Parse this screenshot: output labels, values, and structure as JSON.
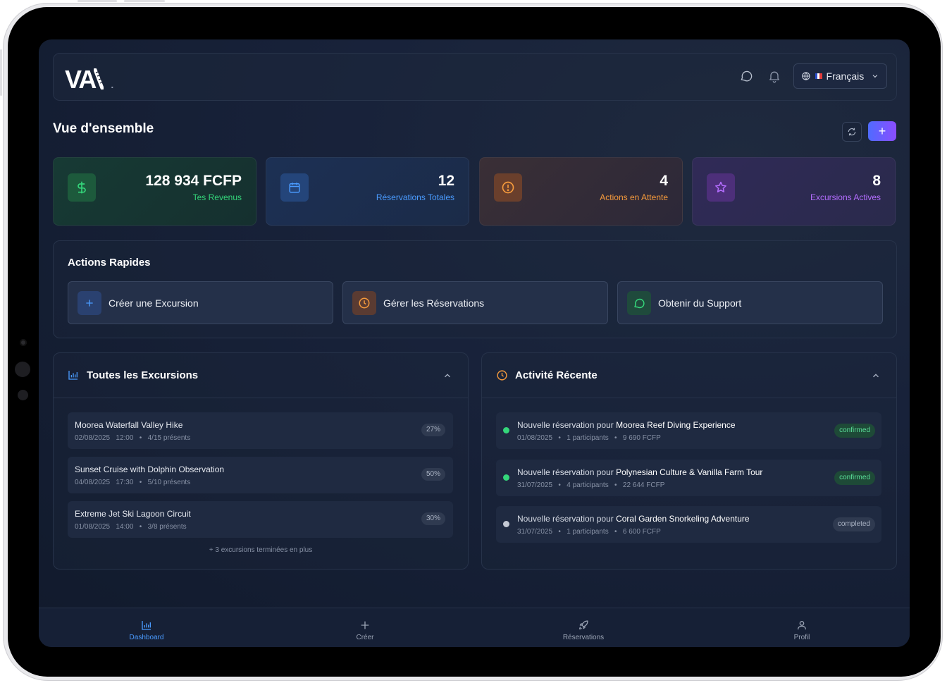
{
  "app": {
    "logo": "VA",
    "logo_suffix": "."
  },
  "header": {
    "language": "Français"
  },
  "page": {
    "title": "Vue d'ensemble",
    "add_label": "+"
  },
  "stats": [
    {
      "value": "128 934 FCFP",
      "label": "Tes Revenus",
      "icon": "dollar-icon",
      "color": "#34d67a"
    },
    {
      "value": "12",
      "label": "Réservations Totales",
      "icon": "calendar-icon",
      "color": "#4a9bff"
    },
    {
      "value": "4",
      "label": "Actions en Attente",
      "icon": "alert-icon",
      "color": "#f59a3c"
    },
    {
      "value": "8",
      "label": "Excursions Actives",
      "icon": "star-icon",
      "color": "#b46dff"
    }
  ],
  "quick_actions": {
    "title": "Actions Rapides",
    "items": [
      {
        "label": "Créer une Excursion",
        "icon": "plus-icon",
        "color": "#4a9bff"
      },
      {
        "label": "Gérer les Réservations",
        "icon": "clock-icon",
        "color": "#f59a3c"
      },
      {
        "label": "Obtenir du Support",
        "icon": "chat-icon",
        "color": "#34d67a"
      }
    ]
  },
  "excursions": {
    "title": "Toutes les Excursions",
    "items": [
      {
        "name": "Moorea Waterfall Valley Hike",
        "date": "02/08/2025",
        "time": "12:00",
        "present": "4/15 présents",
        "pct": "27%"
      },
      {
        "name": "Sunset Cruise with Dolphin Observation",
        "date": "04/08/2025",
        "time": "17:30",
        "present": "5/10 présents",
        "pct": "50%"
      },
      {
        "name": "Extreme Jet Ski Lagoon Circuit",
        "date": "01/08/2025",
        "time": "14:00",
        "present": "3/8 présents",
        "pct": "30%"
      }
    ],
    "more": "+ 3 excursions terminées en plus"
  },
  "activity": {
    "title": "Activité Récente",
    "prefix": "Nouvelle réservation pour",
    "items": [
      {
        "tour": "Moorea Reef Diving Experience",
        "date": "01/08/2025",
        "participants": "1 participants",
        "amount": "9 690 FCFP",
        "status": "confirmed",
        "dot": "#34d67a"
      },
      {
        "tour": "Polynesian Culture & Vanilla Farm Tour",
        "date": "31/07/2025",
        "participants": "4 participants",
        "amount": "22 644 FCFP",
        "status": "confirmed",
        "dot": "#34d67a"
      },
      {
        "tour": "Coral Garden Snorkeling Adventure",
        "date": "31/07/2025",
        "participants": "1 participants",
        "amount": "6 600 FCFP",
        "status": "completed",
        "dot": "#c4c9d4"
      }
    ]
  },
  "nav": [
    {
      "label": "Dashboard",
      "icon": "bar-chart-icon",
      "active": true
    },
    {
      "label": "Créer",
      "icon": "plus-icon",
      "active": false
    },
    {
      "label": "Réservations",
      "icon": "rocket-icon",
      "active": false
    },
    {
      "label": "Profil",
      "icon": "user-icon",
      "active": false
    }
  ]
}
